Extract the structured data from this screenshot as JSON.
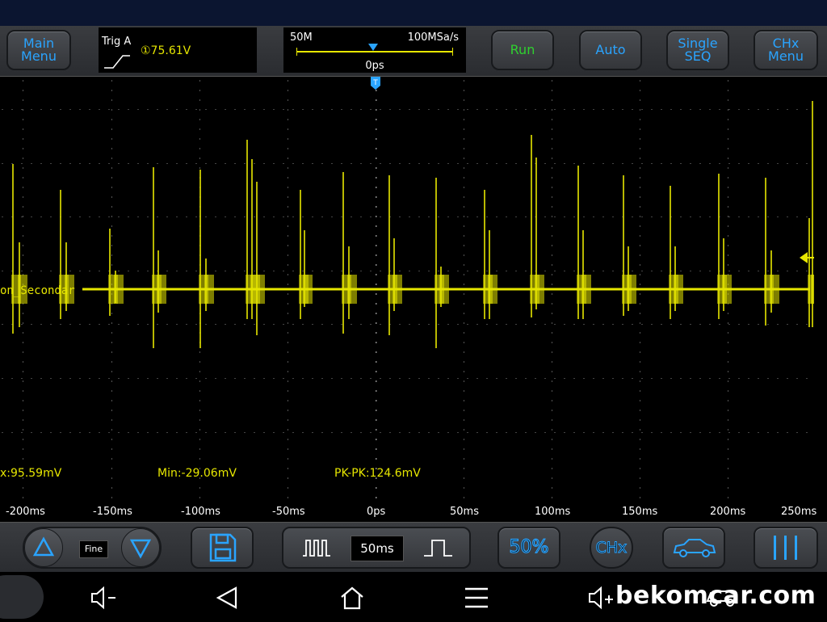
{
  "toolbar": {
    "main_menu": [
      "Main",
      "Menu"
    ],
    "trigger_label": "Trig A",
    "trigger_level": "①75.61V",
    "memory_depth": "50M",
    "sample_rate": "100MSa/s",
    "time_position": "0ps",
    "run": "Run",
    "auto": "Auto",
    "single_seq": [
      "Single",
      "SEQ"
    ],
    "chx_menu": [
      "CHx",
      "Menu"
    ]
  },
  "scope": {
    "trigger_marker": "T",
    "channel_label": "on_Secondar"
  },
  "measurements": {
    "max": "x:95.59mV",
    "min": "Min:-29.06mV",
    "pkpk": "PK-PK:124.6mV"
  },
  "time_axis": [
    "-200ms",
    "-150ms",
    "-100ms",
    "-50ms",
    "0ps",
    "50ms",
    "100ms",
    "150ms",
    "200ms",
    "250ms"
  ],
  "bottom": {
    "fine": "Fine",
    "timebase": "50ms",
    "percent": "50%",
    "chx": "CHx"
  },
  "nav": {
    "watermark": "bekomcar.com"
  },
  "colors": {
    "accent": "#2aa4ff",
    "trace": "#e6e600",
    "run": "#2fd02f"
  }
}
